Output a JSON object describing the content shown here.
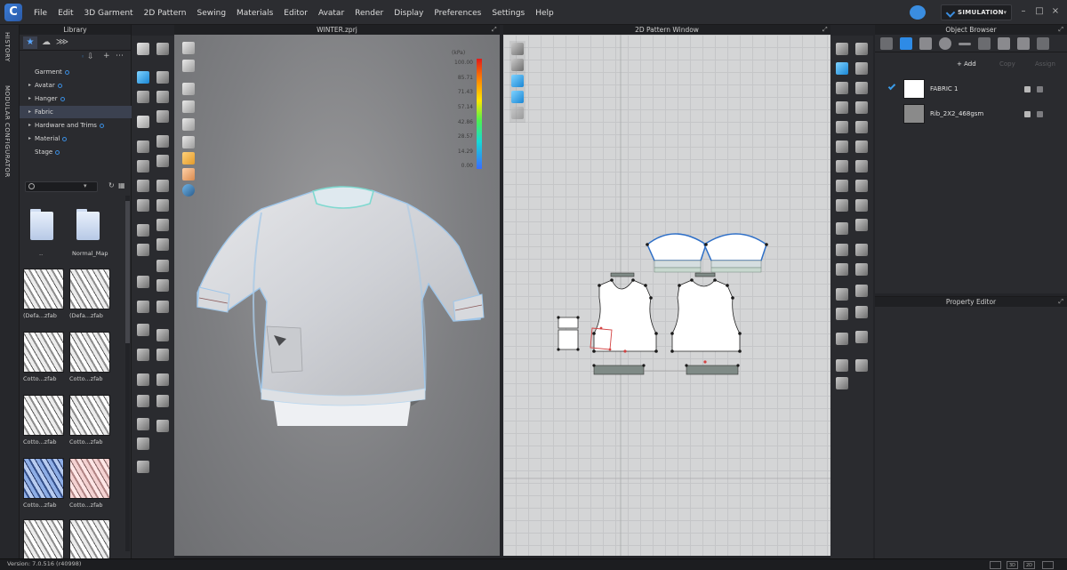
{
  "app": {
    "logo_text": "C",
    "menu": [
      "File",
      "Edit",
      "3D Garment",
      "2D Pattern",
      "Sewing",
      "Materials",
      "Editor",
      "Avatar",
      "Render",
      "Display",
      "Preferences",
      "Settings",
      "Help"
    ],
    "simulation_label": "SIMULATION",
    "window_controls": [
      "–",
      "□",
      "×"
    ]
  },
  "left_strip": {
    "history_tab": "HISTORY",
    "modular_tab": "MODULAR CONFIGURATOR"
  },
  "library": {
    "title": "Library",
    "tree": [
      {
        "label": "Garment",
        "arrow": false
      },
      {
        "label": "Avatar",
        "arrow": true
      },
      {
        "label": "Hanger",
        "arrow": true
      },
      {
        "label": "Fabric",
        "arrow": true,
        "selected": true
      },
      {
        "label": "Hardware and Trims",
        "arrow": true
      },
      {
        "label": "Material",
        "arrow": true
      },
      {
        "label": "Stage",
        "arrow": false
      }
    ],
    "thumbnails": [
      {
        "label": "..",
        "kind": "folder"
      },
      {
        "label": "Normal_Map",
        "kind": "folder"
      },
      {
        "label": "(Defa...zfab",
        "kind": "white"
      },
      {
        "label": "(Defa...zfab",
        "kind": "white"
      },
      {
        "label": "Cotto...zfab",
        "kind": "white"
      },
      {
        "label": "Cotto...zfab",
        "kind": "white"
      },
      {
        "label": "Cotto...zfab",
        "kind": "white"
      },
      {
        "label": "Cotto...zfab",
        "kind": "white"
      },
      {
        "label": "Cotto...zfab",
        "kind": "blue"
      },
      {
        "label": "Cotto...zfab",
        "kind": "pink"
      },
      {
        "label": "",
        "kind": "white"
      },
      {
        "label": "",
        "kind": "white"
      }
    ]
  },
  "view3d": {
    "title": "WINTER.zprj",
    "legend": {
      "unit": "(kPa)",
      "ticks": [
        "100.00",
        "85.71",
        "71.43",
        "57.14",
        "42.86",
        "28.57",
        "14.29",
        "0.00"
      ]
    }
  },
  "view2d": {
    "title": "2D Pattern Window"
  },
  "object_browser": {
    "title": "Object Browser",
    "add_label": "Add",
    "copy_label": "Copy",
    "assign_label": "Assign",
    "items": [
      {
        "name": "FABRIC 1",
        "color": "#ffffff",
        "checked": true
      },
      {
        "name": "Rib_2X2_468gsm",
        "color": "#8a8a8a",
        "checked": false
      }
    ]
  },
  "property_editor": {
    "title": "Property Editor"
  },
  "status": {
    "version": "Version: 7.0.516 (r40998)",
    "buttons": [
      "",
      "3D",
      "2D"
    ]
  },
  "colors": {
    "accent": "#3a8de0",
    "panel": "#2a2b2f",
    "header": "#1f2023"
  }
}
